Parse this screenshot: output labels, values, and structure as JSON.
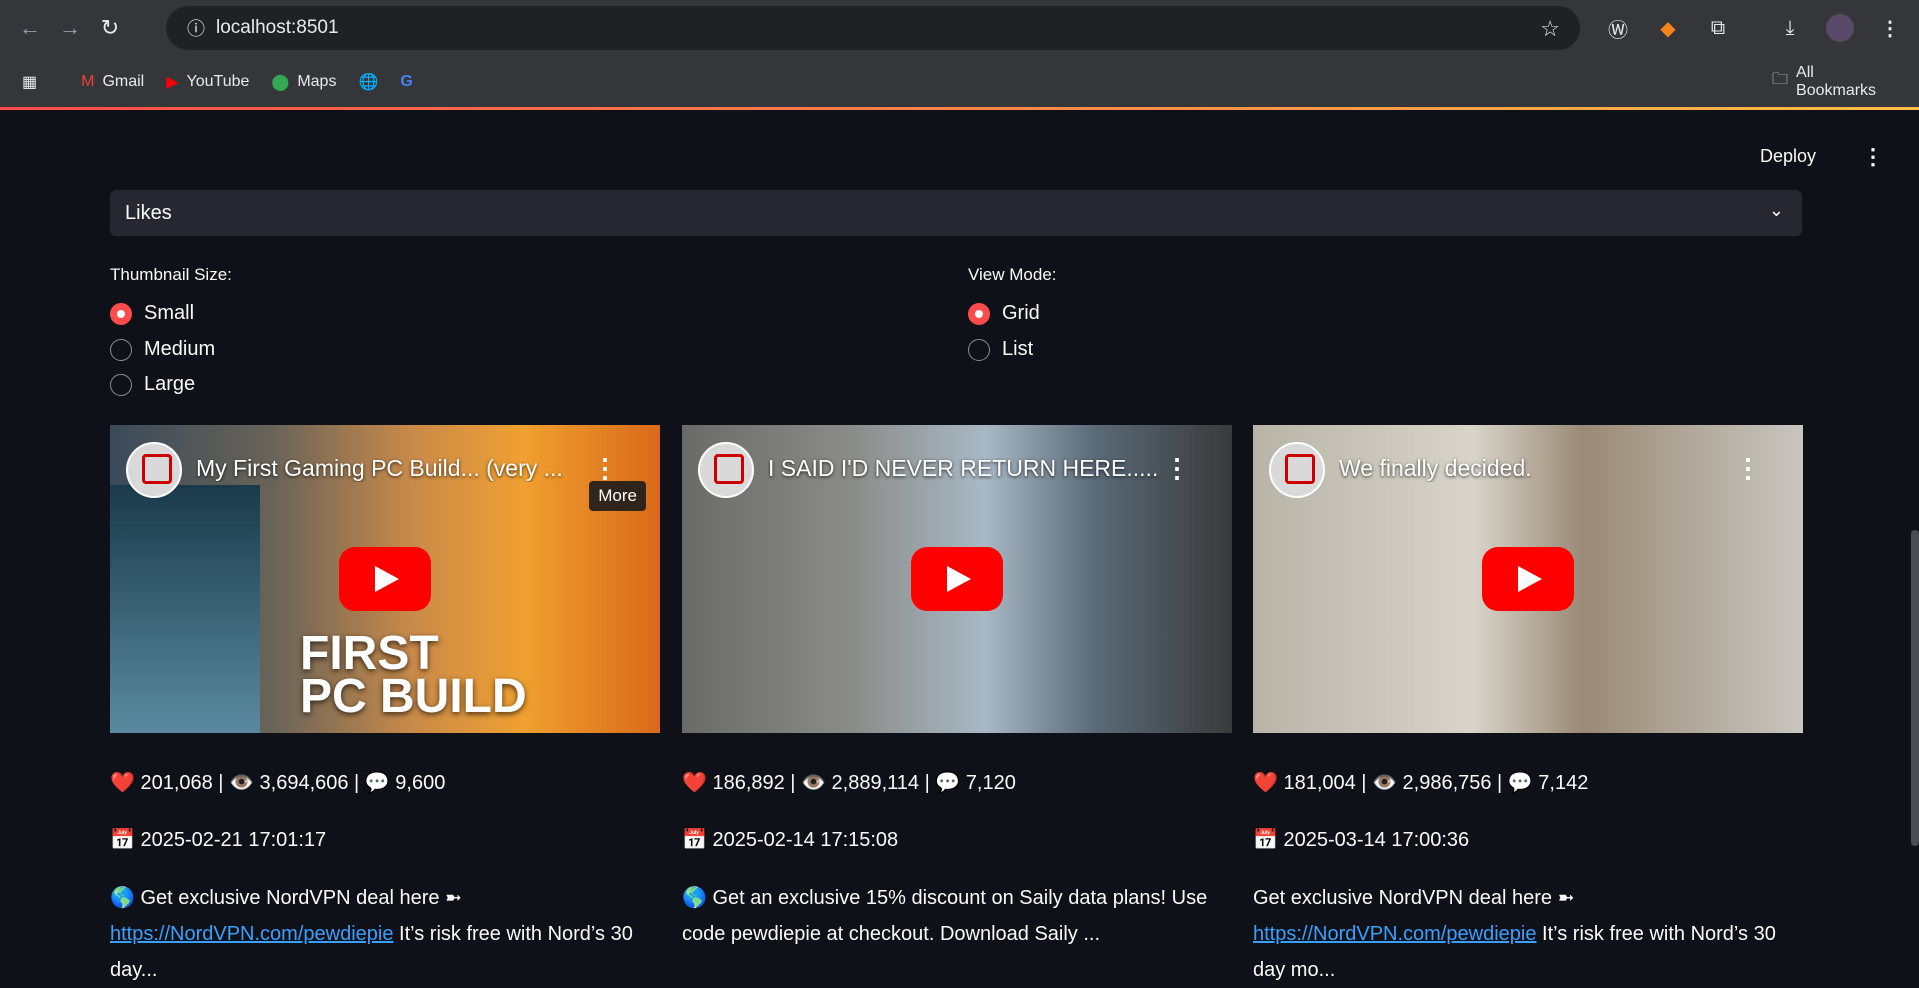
{
  "browser": {
    "url": "localhost:8501",
    "bookmarks": [
      "Gmail",
      "YouTube",
      "Maps"
    ],
    "all_bookmarks": "All Bookmarks"
  },
  "header": {
    "deploy": "Deploy"
  },
  "expander": {
    "label": "Likes"
  },
  "thumbnail_size": {
    "label": "Thumbnail Size:",
    "options": [
      "Small",
      "Medium",
      "Large"
    ],
    "selected": "Small"
  },
  "view_mode": {
    "label": "View Mode:",
    "options": [
      "Grid",
      "List"
    ],
    "selected": "Grid"
  },
  "videos": [
    {
      "title": "My First Gaming PC Build... (very ...",
      "overlay_text": [
        "FIRST",
        "PC BUILD"
      ],
      "tooltip": "More",
      "stats": "❤️ 201,068 | 👁️ 3,694,606 | 💬 9,600",
      "date": "📅 2025-02-21 17:01:17",
      "desc_prefix": "🌎 Get exclusive NordVPN deal here ➼",
      "link": "https://NordVPN.com/pewdiepie",
      "desc_suffix": " It’s risk free with Nord’s 30 day..."
    },
    {
      "title": "I SAID I'D NEVER RETURN HERE.....",
      "stats": "❤️ 186,892 | 👁️ 2,889,114 | 💬 7,120",
      "date": "📅 2025-02-14 17:15:08",
      "desc_text": "🌎 Get an exclusive 15% discount on Saily data plans! Use code pewdiepie at checkout. Download Saily ..."
    },
    {
      "title": "We finally decided.",
      "stats": "❤️ 181,004 | 👁️ 2,986,756 | 💬 7,142",
      "date": "📅 2025-03-14 17:00:36",
      "desc_prefix": "Get exclusive NordVPN deal here ➼",
      "link": "https://NordVPN.com/pewdiepie",
      "desc_suffix": " It’s risk free with Nord’s 30 day mo..."
    }
  ]
}
